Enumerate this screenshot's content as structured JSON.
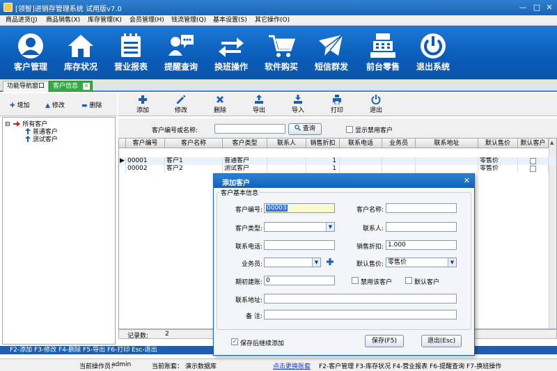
{
  "window": {
    "title": "[领智]进销存管理系统 试用版v7.0",
    "controls": {
      "minimize": "—",
      "maximize": "□",
      "close": "✕"
    }
  },
  "menubar": [
    "商品进货(J)",
    "商品销售(X)",
    "库存管理(K)",
    "会员管理(H)",
    "钱流管理(Q)",
    "基本设置(S)",
    "其它操作(O)"
  ],
  "toolbar": [
    {
      "label": "客户管理",
      "icon": "user-icon"
    },
    {
      "label": "库存状况",
      "icon": "house-icon"
    },
    {
      "label": "营业报表",
      "icon": "report-icon"
    },
    {
      "label": "提醒查询",
      "icon": "chat-icon"
    },
    {
      "label": "换班操作",
      "icon": "swap-icon"
    },
    {
      "label": "软件购买",
      "icon": "cart-icon"
    },
    {
      "label": "短信群发",
      "icon": "envelope-icon"
    },
    {
      "label": "前台零售",
      "icon": "register-icon"
    },
    {
      "label": "退出系统",
      "icon": "power-icon"
    }
  ],
  "tabs": {
    "nav": "功能导航窗口",
    "customer": "客户信息",
    "close": "✕"
  },
  "left_toolbar": {
    "add": "增加",
    "edit": "修改",
    "delete": "删除",
    "add_glyph": "✚",
    "edit_glyph": "▲",
    "delete_glyph": "▬"
  },
  "tree": {
    "root": "所有客户",
    "children": [
      "普通客户",
      "测试客户"
    ],
    "expander": "⊟"
  },
  "main_toolbar": {
    "add": "添加",
    "edit": "修改",
    "delete": "删除",
    "export": "导出",
    "import": "导入",
    "print": "打印",
    "exit": "退出"
  },
  "search": {
    "label": "客户编号或名称:",
    "value": "",
    "button": "查询",
    "show_disabled": "显示禁用客户"
  },
  "grid": {
    "columns": [
      "客户编号",
      "客户名称",
      "客户类型",
      "联系人",
      "销售折扣",
      "联系电话",
      "业务员",
      "联系地址",
      "默认售价",
      "默认客户"
    ],
    "rows": [
      {
        "marker": "▶",
        "code": "00001",
        "name": "客户1",
        "type": "普通客户",
        "contact": "",
        "discount": "1",
        "phone": "",
        "salesman": "",
        "address": "",
        "price": "零售价"
      },
      {
        "marker": "",
        "code": "00002",
        "name": "客户2",
        "type": "测试客户",
        "contact": "",
        "discount": "1",
        "phone": "",
        "salesman": "",
        "address": "",
        "price": "零售价"
      }
    ],
    "record_label": "记录数:",
    "record_count": "2"
  },
  "hotkeys": "F2-添加 F3-修改 F4-删除 F5-导出 F6-打印 Esc-退出",
  "statusbar": {
    "operator_label": "当前操作员：",
    "operator": "admin",
    "account_label": "当前账套：",
    "account": "演示数据库",
    "switch_link": "点击更换账套",
    "shortcuts": "F2-客户管理 F3-库存状况 F4-营业报表 F6-提醒查询 F7-换班操作"
  },
  "dialog": {
    "title": "添加客户",
    "close": "✕",
    "group": "客户基本信息",
    "fields": {
      "code_label": "客户编号:",
      "code_value": "00003",
      "name_label": "客户名称:",
      "name_value": "",
      "type_label": "客户类型:",
      "type_value": "",
      "contact_label": "联系人:",
      "contact_value": "",
      "phone_label": "联系电话:",
      "phone_value": "",
      "discount_label": "销售折扣:",
      "discount_value": "1.000",
      "salesman_label": "业务员:",
      "salesman_value": "",
      "price_label": "默认售价:",
      "price_value": "零售价",
      "opening_label": "期初建账:",
      "opening_value": "0",
      "disable_label": "禁用该客户",
      "default_label": "默认客户",
      "address_label": "联系地址:",
      "address_value": "",
      "remark_label": "备 注:",
      "remark_value": ""
    },
    "continue_label": "保存后继续添加",
    "continue_mark": "✓",
    "save": "保存(F5)",
    "exit": "退出(Esc)"
  },
  "colors": {
    "toolbar": "#0a5cb8",
    "title": "#1e64b4",
    "active_tab": "#37a845",
    "link": "#1c3fc9"
  }
}
